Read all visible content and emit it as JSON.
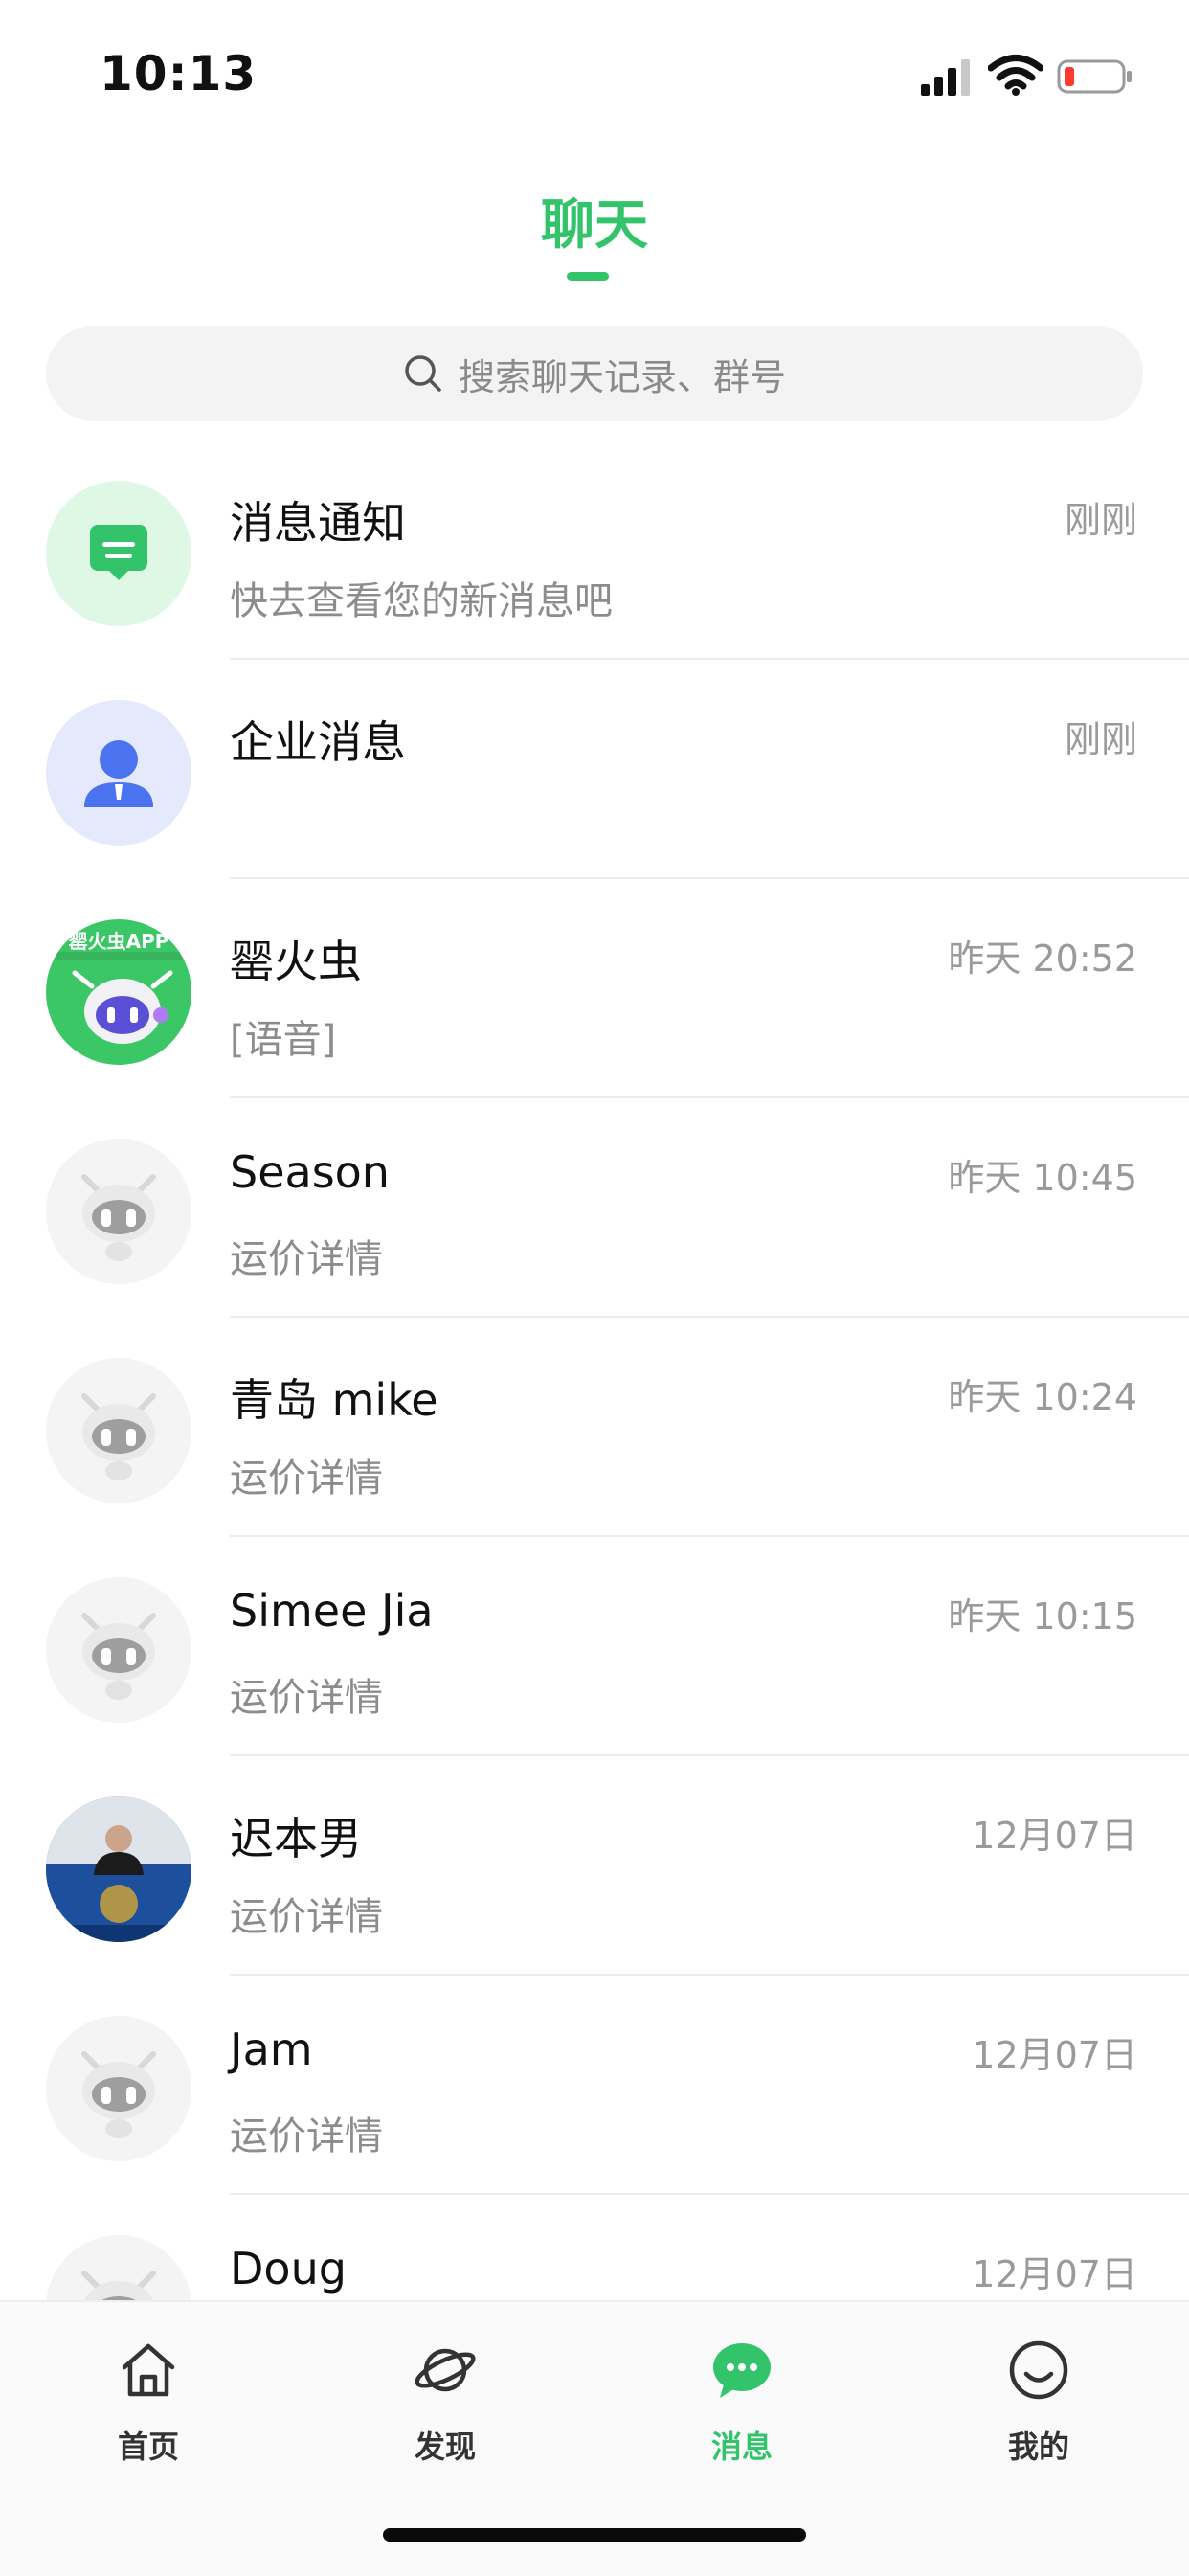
{
  "status_bar": {
    "time": "10:13"
  },
  "header": {
    "title": "聊天"
  },
  "search": {
    "placeholder": "搜索聊天记录、群号"
  },
  "chats": [
    {
      "name": "消息通知",
      "message": "快去查看您的新消息吧",
      "time": "刚刚",
      "avatar": "message-notification-icon"
    },
    {
      "name": "企业消息",
      "message": "",
      "time": "刚刚",
      "avatar": "enterprise-user-icon"
    },
    {
      "name": "罂火虫",
      "message": "[语音]",
      "time": "昨天 20:52",
      "avatar": "robot-brand-avatar",
      "avatar_text": "罂火虫APP"
    },
    {
      "name": "Season",
      "message": "运价详情",
      "time": "昨天 10:45",
      "avatar": "default-robot-avatar"
    },
    {
      "name": "青岛 mike",
      "message": "运价详情",
      "time": "昨天 10:24",
      "avatar": "default-robot-avatar"
    },
    {
      "name": "Simee Jia",
      "message": "运价详情",
      "time": "昨天 10:15",
      "avatar": "default-robot-avatar"
    },
    {
      "name": "迟本男",
      "message": "运价详情",
      "time": "12月07日",
      "avatar": "photo-avatar"
    },
    {
      "name": "Jam",
      "message": "运价详情",
      "time": "12月07日",
      "avatar": "default-robot-avatar"
    },
    {
      "name": "Doug",
      "message": "",
      "time": "12月07日",
      "avatar": "default-robot-avatar"
    }
  ],
  "tabs": [
    {
      "label": "首页",
      "icon": "home-icon",
      "active": false
    },
    {
      "label": "发现",
      "icon": "planet-icon",
      "active": false
    },
    {
      "label": "消息",
      "icon": "chat-bubble-icon",
      "active": true
    },
    {
      "label": "我的",
      "icon": "smile-icon",
      "active": false
    }
  ],
  "colors": {
    "accent": "#33c46b",
    "muted_text": "#8c8c8c"
  }
}
